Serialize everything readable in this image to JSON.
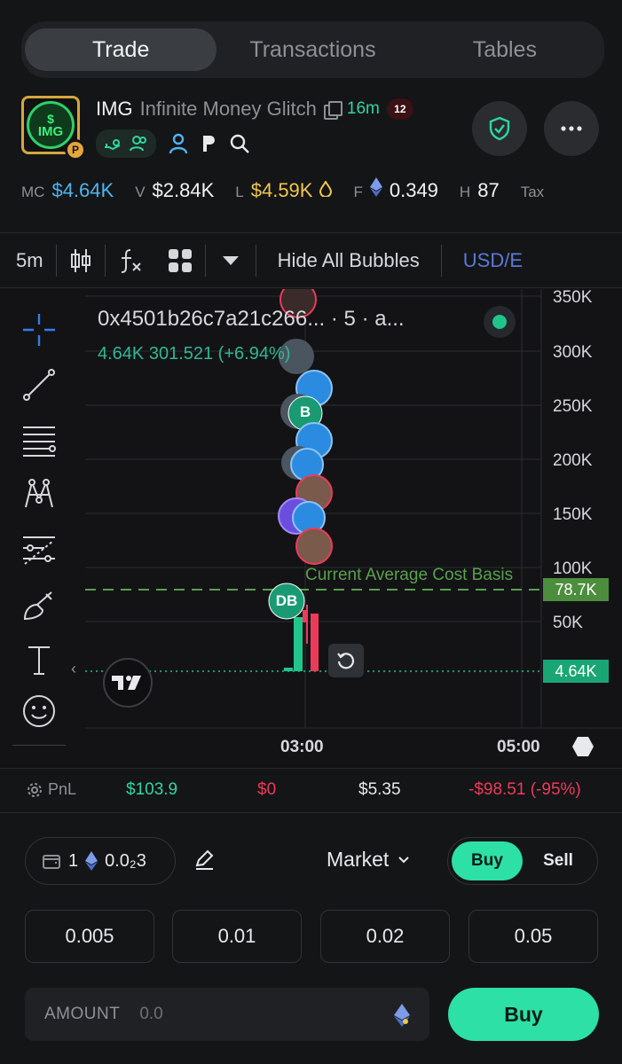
{
  "tabs": [
    {
      "label": "Trade",
      "active": true
    },
    {
      "label": "Transactions",
      "active": false
    },
    {
      "label": "Tables",
      "active": false
    }
  ],
  "token": {
    "logo_symbol": "$",
    "logo_text": "IMG",
    "symbol": "IMG",
    "name": "Infinite Money Glitch",
    "age": "16m",
    "x_badge": "12"
  },
  "stats": [
    {
      "key": "MC",
      "value": "$4.64K",
      "color": "#4fb4ef"
    },
    {
      "key": "V",
      "value": "$2.84K",
      "color": "#f2f3f5"
    },
    {
      "key": "L",
      "value": "$4.59K",
      "color": "#f1c64c"
    },
    {
      "key": "F",
      "value": "0.349",
      "color": "#f2f3f5"
    },
    {
      "key": "H",
      "value": "87",
      "color": "#f2f3f5"
    },
    {
      "key": "Tax",
      "value": "",
      "color": "#8d9096"
    }
  ],
  "toolbar": {
    "interval": "5m",
    "bubbles": "Hide All Bubbles",
    "currency": "USD/E"
  },
  "chart_legend": {
    "pair": "0x4501b26c7a21c266... · 5 · a...",
    "price": "4.64K",
    "change": "301.521 (+6.94%)"
  },
  "chart": {
    "cost_basis_label": "Current Average Cost Basis",
    "cost_basis_tag": "78.7K",
    "current_tag": "4.64K",
    "bubble_b": "B",
    "bubble_db": "DB",
    "time_labels": [
      "03:00",
      "05:00"
    ]
  },
  "chart_data": {
    "type": "line",
    "y_ticks": [
      "350K",
      "300K",
      "250K",
      "200K",
      "150K",
      "100K",
      "50K"
    ],
    "x_ticks": [
      "03:00",
      "05:00"
    ],
    "hlines": [
      {
        "name": "Current Average Cost Basis",
        "value": 78.7
      },
      {
        "name": "current",
        "value": 4.64
      }
    ]
  },
  "pnl": {
    "label": "PnL",
    "bought": "$103.9",
    "sold": "$0",
    "holding": "$5.35",
    "pnl": "-$98.51 (-95%)"
  },
  "order": {
    "wallet_count": "1",
    "balance": "0.0₂3",
    "type": "Market",
    "buy_label": "Buy",
    "sell_label": "Sell",
    "quick_amounts": [
      "0.005",
      "0.01",
      "0.02",
      "0.05"
    ],
    "amount_label": "AMOUNT",
    "amount_placeholder": "0.0",
    "submit": "Buy"
  },
  "colors": {
    "accent": "#2ce0a6",
    "positive": "#2fd69f",
    "negative": "#ee3a5a",
    "cost_basis": "#58a14c"
  }
}
